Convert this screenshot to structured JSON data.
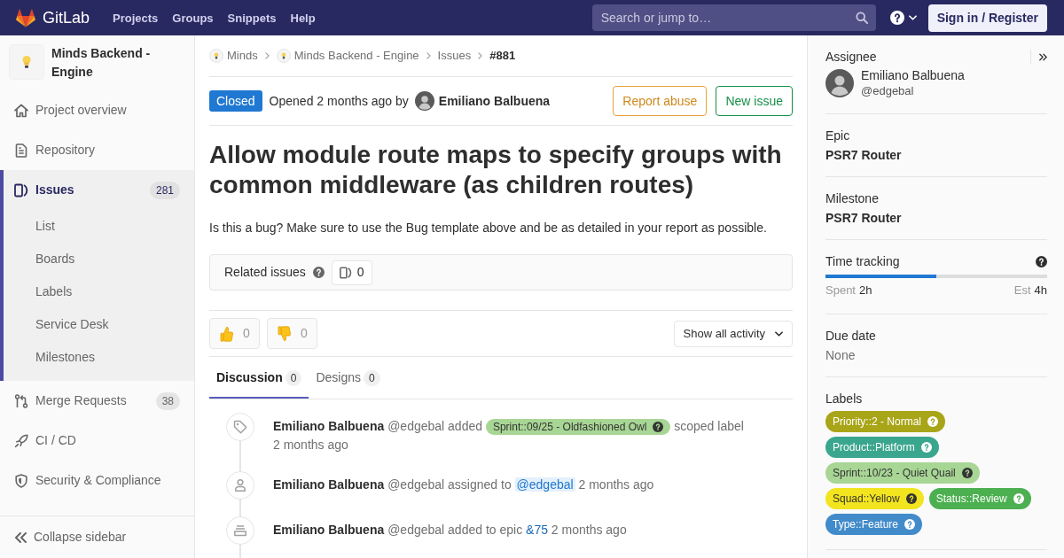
{
  "top_nav": {
    "brand": "GitLab",
    "links": [
      "Projects",
      "Groups",
      "Snippets",
      "Help"
    ],
    "search": {
      "placeholder": "Search or jump to…"
    },
    "sign_in": "Sign in / Register"
  },
  "sidebar": {
    "project": "Minds Backend - Engine",
    "items": [
      {
        "label": "Project overview",
        "kind": "overview",
        "selected": false
      },
      {
        "label": "Repository",
        "kind": "repository",
        "selected": false
      },
      {
        "label": "Issues",
        "kind": "issues",
        "selected": true,
        "count": "281",
        "children": [
          {
            "label": "List",
            "selected": false
          },
          {
            "label": "Boards",
            "selected": false
          },
          {
            "label": "Labels",
            "selected": false
          },
          {
            "label": "Service Desk",
            "selected": false
          },
          {
            "label": "Milestones",
            "selected": false
          }
        ]
      },
      {
        "label": "Merge Requests",
        "kind": "merge_requests",
        "selected": false,
        "count": "38"
      },
      {
        "label": "CI / CD",
        "kind": "ci_cd",
        "selected": false
      },
      {
        "label": "Security & Compliance",
        "kind": "security",
        "selected": false
      }
    ],
    "collapse": "Collapse sidebar"
  },
  "breadcrumbs": [
    {
      "label": "Minds",
      "kind": "avatar"
    },
    {
      "label": "Minds Backend - Engine",
      "kind": "avatar"
    },
    {
      "label": "Issues",
      "kind": "link"
    },
    {
      "label": "#881",
      "kind": "current"
    }
  ],
  "issue": {
    "status": {
      "label": "Closed",
      "kind": "closed"
    },
    "opened": "Opened 2 months ago by",
    "author": "Emiliano Balbuena",
    "actions": [
      {
        "label": "Report abuse",
        "kind": "warning"
      },
      {
        "label": "New issue",
        "kind": "success"
      }
    ],
    "title": "Allow module route maps to specify groups with common middleware (as children routes)",
    "description": "Is this a bug? Make sure to use the Bug template above and be as detailed in your report as possible.",
    "related": {
      "label": "Related issues",
      "count": "0"
    },
    "awards": [
      {
        "kind": "thumbs_up",
        "count": "0"
      },
      {
        "kind": "thumbs_down",
        "count": "0"
      }
    ],
    "activity_filter": "Show all activity"
  },
  "tabs": [
    {
      "label": "Discussion",
      "count": "0",
      "selected": true
    },
    {
      "label": "Designs",
      "count": "0",
      "selected": false
    }
  ],
  "activity": [
    {
      "kind": "label",
      "author": "Emiliano Balbuena",
      "handle": "@edgebal",
      "action": "added",
      "label": {
        "text": "Sprint::09/25 - Oldfashioned Owl",
        "color": "#a8d695"
      },
      "after": "scoped label",
      "time": "2 months ago"
    },
    {
      "kind": "assign",
      "author": "Emiliano Balbuena",
      "handle": "@edgebal",
      "action": "assigned to",
      "mention": "@edgebal",
      "time": "2 months ago"
    },
    {
      "kind": "epic",
      "author": "Emiliano Balbuena",
      "handle": "@edgebal",
      "action": "added to epic",
      "reference": "&75",
      "time": "2 months ago"
    }
  ],
  "right_sidebar": {
    "sections": [
      {
        "kind": "assignee",
        "title": "Assignee",
        "name": "Emiliano Balbuena",
        "handle": "@edgebal"
      },
      {
        "kind": "value",
        "title": "Epic",
        "value": "PSR7 Router"
      },
      {
        "kind": "value",
        "title": "Milestone",
        "value": "PSR7 Router"
      },
      {
        "kind": "time",
        "title": "Time tracking",
        "level": 0.5,
        "spent_label": "Spent",
        "spent": "2h",
        "estimate_label": "Est",
        "estimate": "4h"
      },
      {
        "kind": "empty",
        "title": "Due date",
        "value": "None"
      },
      {
        "kind": "labels",
        "title": "Labels",
        "labels": [
          {
            "text": "Priority::2 - Normal",
            "color": "#a9a518"
          },
          {
            "text": "Product::Platform",
            "color": "#3aa68e"
          },
          {
            "text": "Sprint::10/23 - Quiet Quail",
            "color": "#a8d695"
          },
          {
            "text": "Squad::Yellow",
            "color": "#f2e41e"
          },
          {
            "text": "Status::Review",
            "color": "#4caf50"
          },
          {
            "text": "Type::Feature",
            "color": "#428bca"
          }
        ]
      }
    ]
  }
}
